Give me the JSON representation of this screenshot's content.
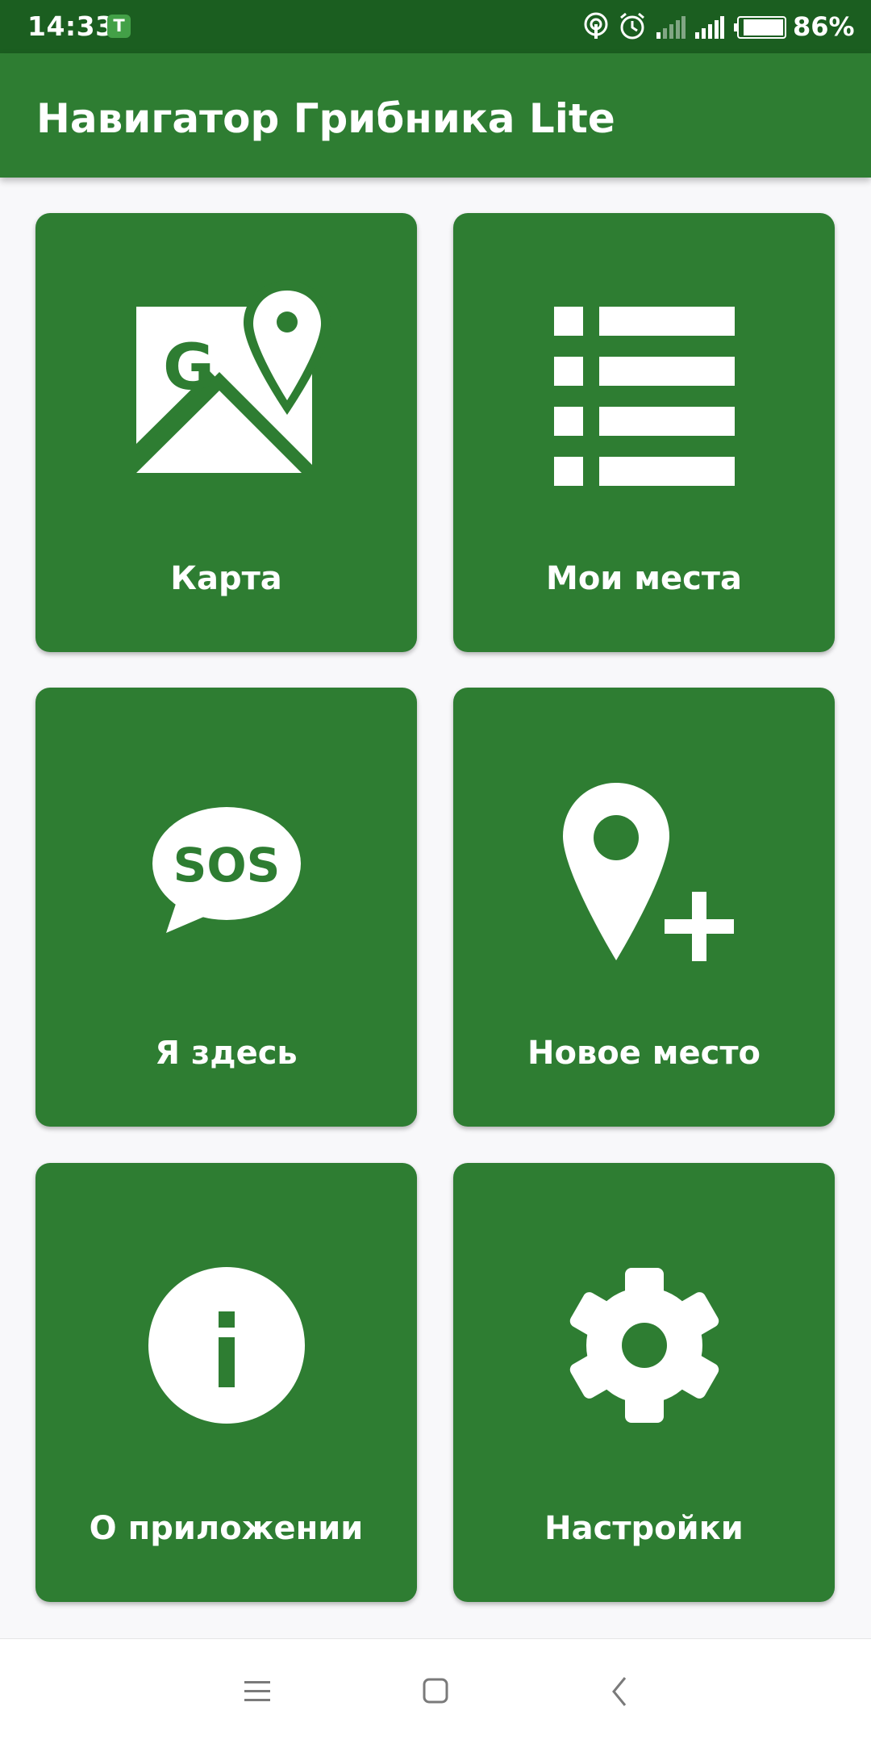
{
  "status_bar": {
    "time": "14:33",
    "app_icon_letter": "T",
    "battery": "86%",
    "icons": [
      "hotspot-icon",
      "alarm-icon",
      "signal-weak-icon",
      "signal-icon",
      "battery-icon"
    ]
  },
  "app_bar": {
    "title": "Навигатор Грибника Lite"
  },
  "tiles": [
    {
      "label": "Карта",
      "icon": "map-icon"
    },
    {
      "label": "Мои места",
      "icon": "list-icon"
    },
    {
      "label": "Я здесь",
      "icon": "sos-icon"
    },
    {
      "label": "Новое место",
      "icon": "add-location-icon"
    },
    {
      "label": "О приложении",
      "icon": "info-icon"
    },
    {
      "label": "Настройки",
      "icon": "gear-icon"
    }
  ],
  "sos_text": "SOS",
  "map_letter": "G",
  "colors": {
    "status_bar": "#1B5E20",
    "primary": "#2E7D32",
    "background": "#F8F8FA",
    "text_on_primary": "#FFFFFF"
  },
  "nav_bar": {
    "buttons": [
      "menu-icon",
      "home-icon",
      "back-icon"
    ]
  }
}
